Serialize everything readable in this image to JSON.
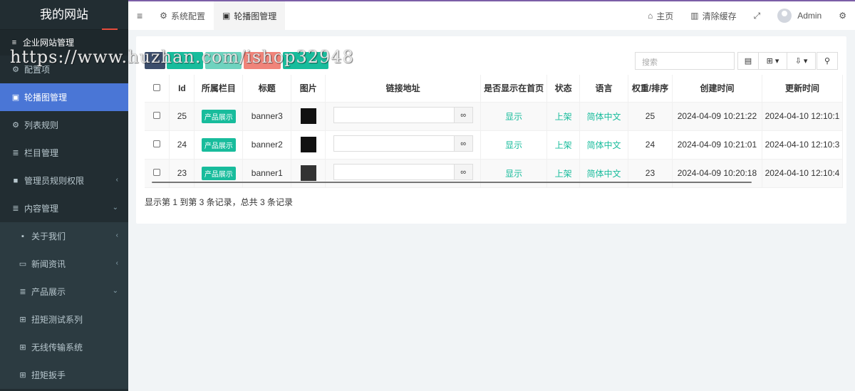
{
  "sidebar": {
    "site_name": "我的网站",
    "header": "企业网站管理",
    "items": [
      {
        "label": "配置项",
        "icon": "gears-icon"
      },
      {
        "label": "轮播图管理",
        "icon": "image-icon"
      },
      {
        "label": "列表规则",
        "icon": "gear-icon"
      },
      {
        "label": "栏目管理",
        "icon": "list-icon"
      },
      {
        "label": "管理员规则权限",
        "icon": "lock-icon",
        "arrow": "‹"
      },
      {
        "label": "内容管理",
        "icon": "list-icon",
        "arrow": "⌄"
      },
      {
        "label": "关于我们",
        "icon": "user-box-icon",
        "arrow": "‹"
      },
      {
        "label": "新闻资讯",
        "icon": "newspaper-icon",
        "arrow": "‹"
      },
      {
        "label": "产品展示",
        "icon": "list-icon",
        "arrow": "⌄"
      },
      {
        "label": "扭矩测试系列",
        "icon": "grid-icon"
      },
      {
        "label": "无线传输系统",
        "icon": "grid-icon"
      },
      {
        "label": "扭矩扳手",
        "icon": "grid-icon"
      }
    ]
  },
  "topbar": {
    "tabs": [
      {
        "label": "系统配置"
      },
      {
        "label": "轮播图管理"
      }
    ],
    "home": "主页",
    "clear_cache": "清除缓存",
    "user": "Admin"
  },
  "toolbar": {
    "search_placeholder": "搜索"
  },
  "table": {
    "headers": [
      "",
      "Id",
      "所属栏目",
      "标题",
      "图片",
      "链接地址",
      "是否显示在首页",
      "状态",
      "语言",
      "权重/排序",
      "创建时间",
      "更新时间"
    ],
    "rows": [
      {
        "id": "25",
        "category": "产品展示",
        "title": "banner3",
        "show_home": "显示",
        "status": "上架",
        "lang": "简体中文",
        "weight": "25",
        "created": "2024-04-09 10:21:22",
        "updated": "2024-04-10 12:10:1"
      },
      {
        "id": "24",
        "category": "产品展示",
        "title": "banner2",
        "show_home": "显示",
        "status": "上架",
        "lang": "简体中文",
        "weight": "24",
        "created": "2024-04-09 10:21:01",
        "updated": "2024-04-10 12:10:3"
      },
      {
        "id": "23",
        "category": "产品展示",
        "title": "banner1",
        "show_home": "显示",
        "status": "上架",
        "lang": "简体中文",
        "weight": "23",
        "created": "2024-04-09 10:20:18",
        "updated": "2024-04-10 12:10:4"
      }
    ]
  },
  "summary": "显示第 1 到第 3 条记录，总共 3 条记录",
  "watermark": "https://www.huzhan.com/ishop32948",
  "colors": {
    "sidebar": "#222d32",
    "active": "#4a76d6",
    "accent": "#18bc9c",
    "danger": "#f0847a",
    "topborder": "#7b5ea7"
  }
}
